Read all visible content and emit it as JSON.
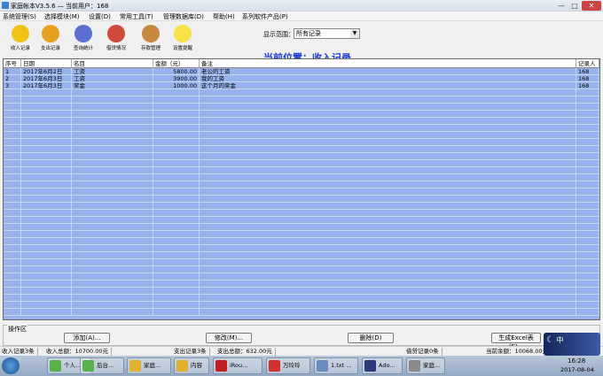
{
  "window": {
    "title": "家庭帐本V3.5.6  —  当前用户：168",
    "minimize": "—",
    "maximize": "□",
    "close": "✕"
  },
  "menu": [
    "系统管理(S)",
    "选择模块(M)",
    "设置(D)",
    "常用工具(T)",
    "管理数据库(D)",
    "帮助(H)",
    "系列软件产品(P)"
  ],
  "toolbar": [
    {
      "label": "收入记录",
      "icon": "income-icon",
      "color": "#f2c21b"
    },
    {
      "label": "支出记录",
      "icon": "expense-icon",
      "color": "#e8a020"
    },
    {
      "label": "查询统计",
      "icon": "query-icon",
      "color": "#5a6fd0"
    },
    {
      "label": "借贷情况",
      "icon": "loan-icon",
      "color": "#d04a3a"
    },
    {
      "label": "存款管理",
      "icon": "deposit-icon",
      "color": "#c88840"
    },
    {
      "label": "设置提醒",
      "icon": "lightbulb-icon",
      "color": "#f7e24a"
    }
  ],
  "range": {
    "label": "显示范围：",
    "value": "所有记录"
  },
  "location": "当前位置：收入记录",
  "table": {
    "columns": [
      "序号",
      "日期",
      "名目",
      "金额（元）",
      "备注",
      "记录人"
    ],
    "rows": [
      [
        "1",
        "2017年6月2日",
        "工资",
        "5800.00",
        "老公的工资",
        "168"
      ],
      [
        "2",
        "2017年6月3日",
        "工资",
        "3900.00",
        "我的工资",
        "168"
      ],
      [
        "3",
        "2017年6月3日",
        "奖金",
        "1000.00",
        "这个月的奖金",
        "168"
      ]
    ]
  },
  "ops": {
    "legend": "操作区",
    "add": "添加(A)...",
    "edit": "修改(M)...",
    "delete": "删除(D)",
    "excel": "生成Excel表(E)..."
  },
  "status": [
    "收入记录3条",
    "收入总额：10700.00元",
    "支出记录3条",
    "支出总额：632.00元",
    "借贷记录0条",
    "当前余额：10068.00元"
  ],
  "tasks": [
    {
      "label": "个人...",
      "color": "#5ab04a"
    },
    {
      "label": "后台...",
      "color": "#5ab04a"
    },
    {
      "label": "家庭...",
      "color": "#e0b030"
    },
    {
      "label": "内容",
      "color": "#e0b030"
    },
    {
      "label": "iRou...",
      "color": "#c02020"
    },
    {
      "label": "万玲玲",
      "color": "#d03030"
    },
    {
      "label": "1.txt ...",
      "color": "#6a8ac0"
    },
    {
      "label": "Ado...",
      "color": "#2a3a7a"
    },
    {
      "label": "家庭...",
      "color": "#8a8a8a"
    }
  ],
  "clock": {
    "time": "16:28",
    "date": "2017-08-04"
  },
  "widget": "中"
}
